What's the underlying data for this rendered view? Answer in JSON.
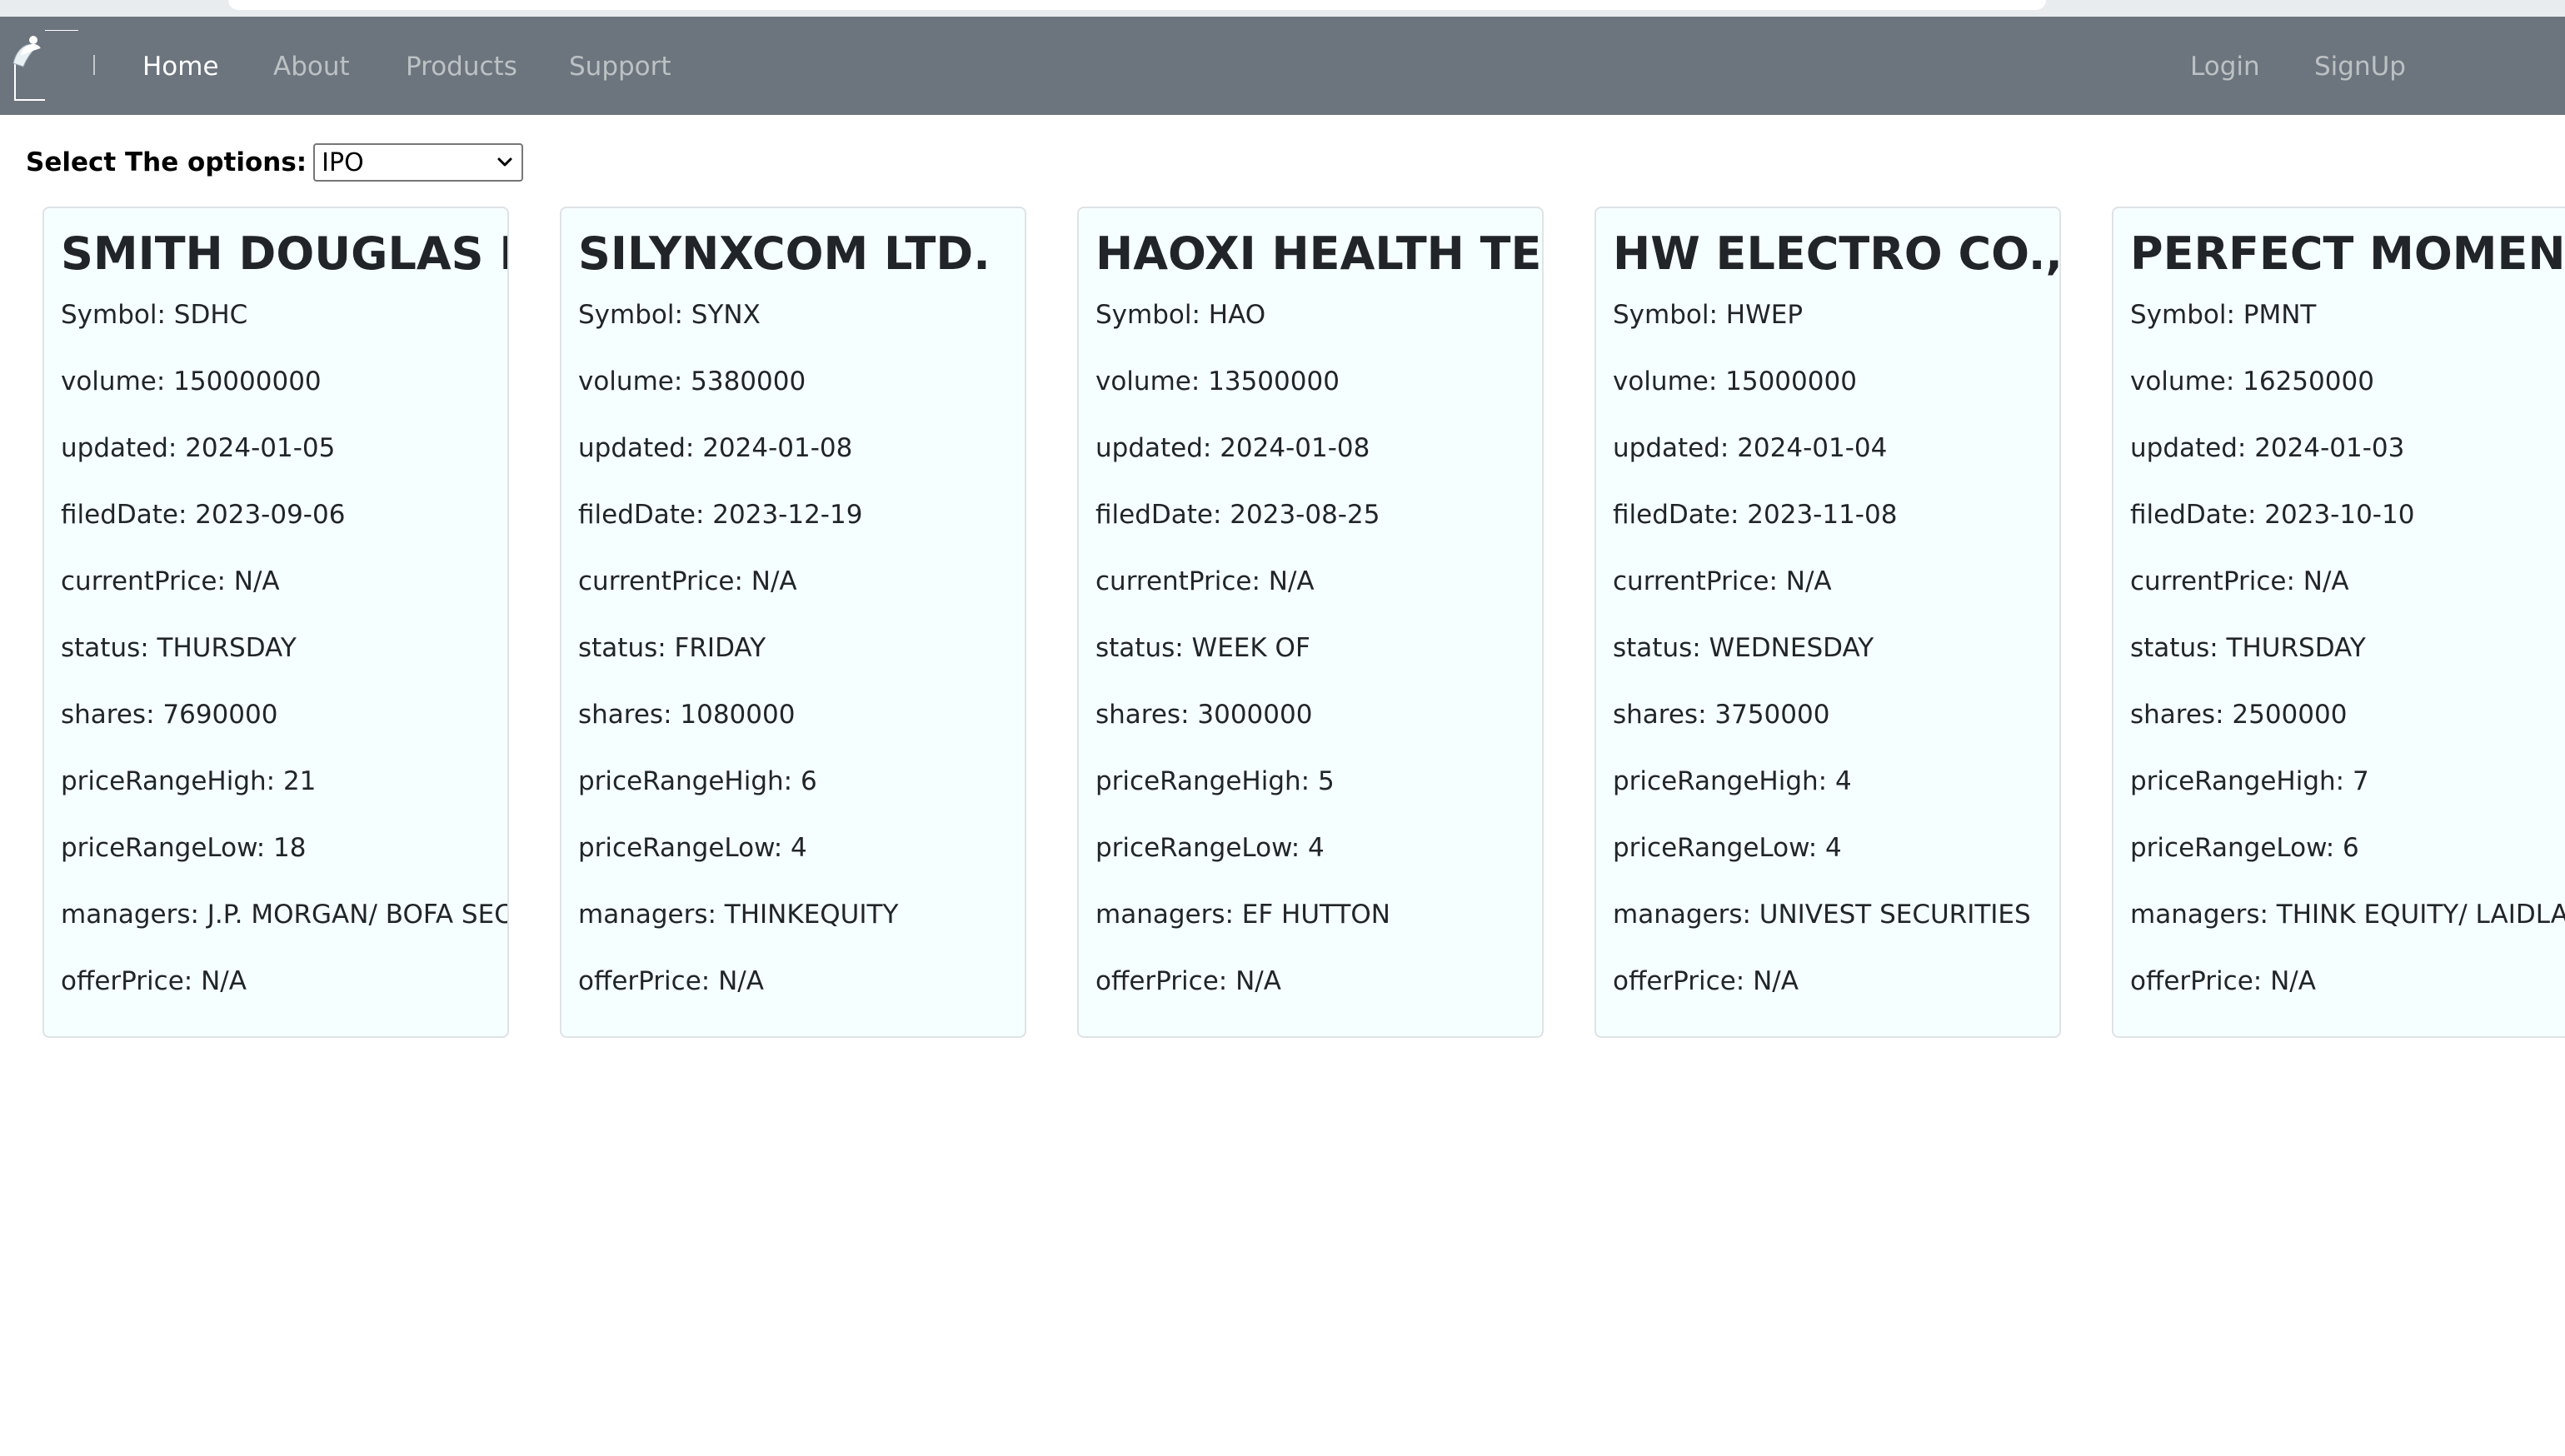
{
  "navbar": {
    "brand_logo": "broken-image-icon",
    "links": [
      {
        "label": "Home",
        "active": true
      },
      {
        "label": "About",
        "active": false
      },
      {
        "label": "Products",
        "active": false
      },
      {
        "label": "Support",
        "active": false
      }
    ],
    "auth": {
      "login": "Login",
      "signup": "SignUp"
    }
  },
  "options": {
    "label": "Select The options:",
    "selected": "IPO"
  },
  "colors": {
    "navbar_bg": "#6c757d",
    "card_bg": "#f6ffff",
    "card_border": "#dfe3e6"
  },
  "cards": [
    {
      "title": "SMITH DOUGLAS HOMES CORP.",
      "symbol": "Symbol: SDHC",
      "volume": "volume: 150000000",
      "updated": "updated: 2024-01-05",
      "filedDate": "filedDate: 2023-09-06",
      "currentPrice": "currentPrice: N/A",
      "status": "status: THURSDAY",
      "shares": "shares: 7690000",
      "priceRangeHigh": "priceRangeHigh: 21",
      "priceRangeLow": "priceRangeLow: 18",
      "managers": "managers: J.P. MORGAN/ BOFA SECURITIES",
      "offerPrice": "offerPrice: N/A"
    },
    {
      "title": "SILYNXCOM LTD.",
      "symbol": "Symbol: SYNX",
      "volume": "volume: 5380000",
      "updated": "updated: 2024-01-08",
      "filedDate": "filedDate: 2023-12-19",
      "currentPrice": "currentPrice: N/A",
      "status": "status: FRIDAY",
      "shares": "shares: 1080000",
      "priceRangeHigh": "priceRangeHigh: 6",
      "priceRangeLow": "priceRangeLow: 4",
      "managers": "managers: THINKEQUITY",
      "offerPrice": "offerPrice: N/A"
    },
    {
      "title": "HAOXI HEALTH TECHNOLOGY",
      "symbol": "Symbol: HAO",
      "volume": "volume: 13500000",
      "updated": "updated: 2024-01-08",
      "filedDate": "filedDate: 2023-08-25",
      "currentPrice": "currentPrice: N/A",
      "status": "status: WEEK OF",
      "shares": "shares: 3000000",
      "priceRangeHigh": "priceRangeHigh: 5",
      "priceRangeLow": "priceRangeLow: 4",
      "managers": "managers: EF HUTTON",
      "offerPrice": "offerPrice: N/A"
    },
    {
      "title": "HW ELECTRO CO., LTD.",
      "symbol": "Symbol: HWEP",
      "volume": "volume: 15000000",
      "updated": "updated: 2024-01-04",
      "filedDate": "filedDate: 2023-11-08",
      "currentPrice": "currentPrice: N/A",
      "status": "status: WEDNESDAY",
      "shares": "shares: 3750000",
      "priceRangeHigh": "priceRangeHigh: 4",
      "priceRangeLow": "priceRangeLow: 4",
      "managers": "managers: UNIVEST SECURITIES",
      "offerPrice": "offerPrice: N/A"
    },
    {
      "title": "PERFECT MOMENT LTD.",
      "symbol": "Symbol: PMNT",
      "volume": "volume: 16250000",
      "updated": "updated: 2024-01-03",
      "filedDate": "filedDate: 2023-10-10",
      "currentPrice": "currentPrice: N/A",
      "status": "status: THURSDAY",
      "shares": "shares: 2500000",
      "priceRangeHigh": "priceRangeHigh: 7",
      "priceRangeLow": "priceRangeLow: 6",
      "managers": "managers: THINK EQUITY/ LAIDLAW",
      "offerPrice": "offerPrice: N/A"
    }
  ]
}
